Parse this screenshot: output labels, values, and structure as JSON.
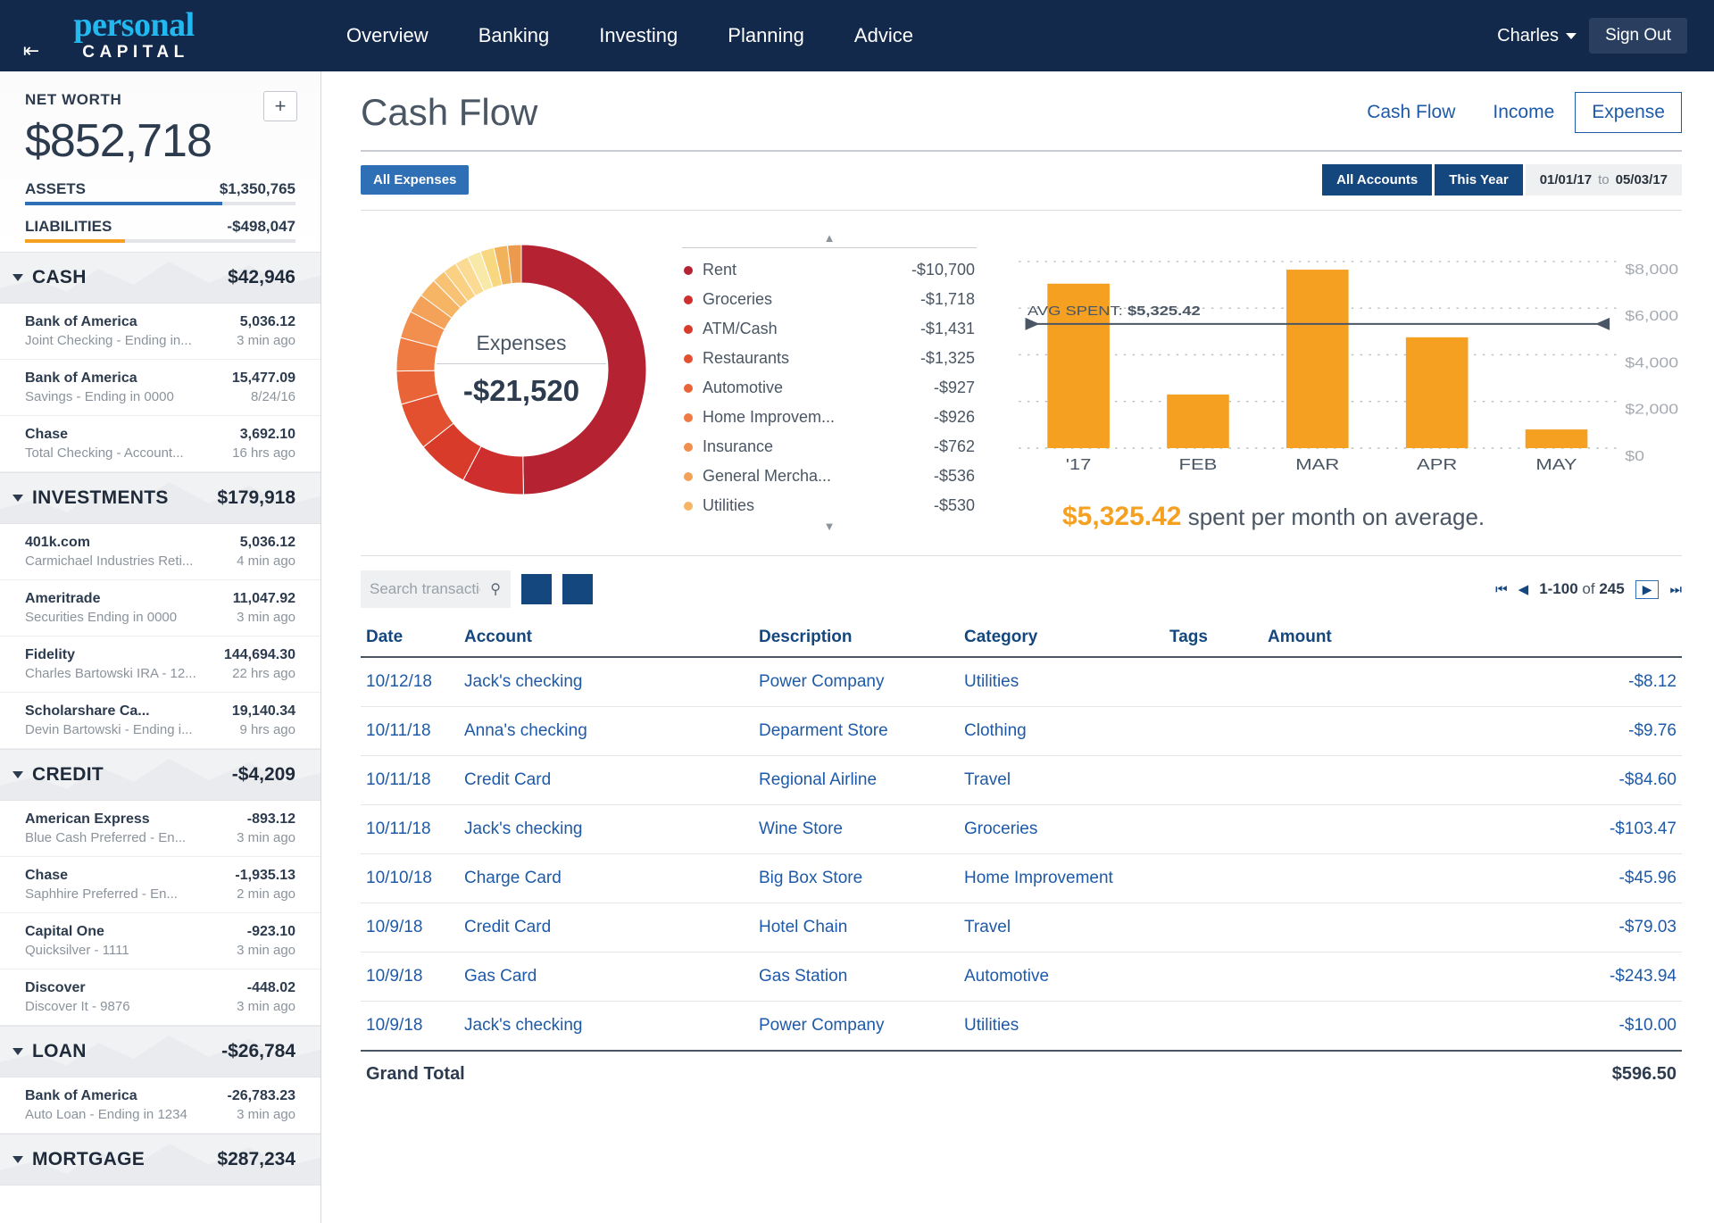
{
  "nav": {
    "collapse_icon": "collapse-left-icon",
    "brand_top": "personal",
    "brand_bottom": "CAPITAL",
    "links": [
      "Overview",
      "Banking",
      "Investing",
      "Planning",
      "Advice"
    ],
    "user": "Charles",
    "signout": "Sign Out"
  },
  "sidebar": {
    "net_worth_label": "NET WORTH",
    "net_worth_value": "$852,718",
    "add_label": "+",
    "assets_label": "ASSETS",
    "assets_value": "$1,350,765",
    "assets_color": "#2f6fb5",
    "liabilities_label": "LIABILITIES",
    "liabilities_value": "-$498,047",
    "liabilities_color": "#f6a022",
    "sections": [
      {
        "title": "CASH",
        "amount": "$42,946",
        "accounts": [
          {
            "name": "Bank of America",
            "sub": "Joint Checking - Ending in...",
            "value": "5,036.12",
            "time": "3 min ago"
          },
          {
            "name": "Bank of America",
            "sub": "Savings - Ending in 0000",
            "value": "15,477.09",
            "time": "8/24/16"
          },
          {
            "name": "Chase",
            "sub": "Total Checking - Account...",
            "value": "3,692.10",
            "time": "16 hrs ago"
          }
        ]
      },
      {
        "title": "INVESTMENTS",
        "amount": "$179,918",
        "accounts": [
          {
            "name": "401k.com",
            "sub": "Carmichael Industries Reti...",
            "value": "5,036.12",
            "time": "4 min ago"
          },
          {
            "name": "Ameritrade",
            "sub": "Securities Ending in 0000",
            "value": "11,047.92",
            "time": "3 min ago"
          },
          {
            "name": "Fidelity",
            "sub": "Charles Bartowski IRA - 12...",
            "value": "144,694.30",
            "time": "22 hrs ago"
          },
          {
            "name": "Scholarshare Ca...",
            "sub": "Devin Bartowski - Ending i...",
            "value": "19,140.34",
            "time": "9 hrs ago"
          }
        ]
      },
      {
        "title": "CREDIT",
        "amount": "-$4,209",
        "accounts": [
          {
            "name": "American Express",
            "sub": "Blue Cash Preferred - En...",
            "value": "-893.12",
            "time": "3 min ago"
          },
          {
            "name": "Chase",
            "sub": "Saphhire Preferred - En...",
            "value": "-1,935.13",
            "time": "2 min ago"
          },
          {
            "name": "Capital One",
            "sub": "Quicksilver - 1111",
            "value": "-923.10",
            "time": "3 min ago"
          },
          {
            "name": "Discover",
            "sub": "Discover It - 9876",
            "value": "-448.02",
            "time": "3 min ago"
          }
        ]
      },
      {
        "title": "LOAN",
        "amount": "-$26,784",
        "accounts": [
          {
            "name": "Bank of America",
            "sub": "Auto Loan - Ending in 1234",
            "value": "-26,783.23",
            "time": "3 min ago"
          }
        ]
      },
      {
        "title": "MORTGAGE",
        "amount": "$287,234",
        "accounts": []
      }
    ]
  },
  "page": {
    "title": "Cash Flow",
    "tabs": [
      {
        "label": "Cash Flow",
        "active": false
      },
      {
        "label": "Income",
        "active": false
      },
      {
        "label": "Expense",
        "active": true
      }
    ],
    "filter_left": "All Expenses",
    "accounts_filter": "All Accounts",
    "period_filter": "This Year",
    "date_from": "01/01/17",
    "date_to_word": "to",
    "date_to": "05/03/17"
  },
  "chart_data": [
    {
      "type": "pie",
      "title": "Expenses",
      "center_value": "-$21,520",
      "total": -21520,
      "categories": [
        "Rent",
        "Groceries",
        "ATM/Cash",
        "Restaurants",
        "Automotive",
        "Home Improvem...",
        "Insurance",
        "General Mercha...",
        "Utilities"
      ],
      "values": [
        -10700,
        -1718,
        -1431,
        -1325,
        -927,
        -926,
        -762,
        -536,
        -530
      ],
      "labels": [
        "-$10,700",
        "-$1,718",
        "-$1,431",
        "-$1,325",
        "-$927",
        "-$926",
        "-$762",
        "-$536",
        "-$530"
      ],
      "colors": [
        "#b52332",
        "#cf2e2e",
        "#d93b2b",
        "#e2502f",
        "#e96437",
        "#ef7a42",
        "#f28e4e",
        "#f4a259",
        "#f6b465"
      ],
      "legend_position": "right"
    },
    {
      "type": "bar",
      "title": "",
      "categories": [
        "'17",
        "FEB",
        "MAR",
        "APR",
        "MAY"
      ],
      "values": [
        7050,
        2300,
        7650,
        4750,
        800
      ],
      "ylim": [
        0,
        8800
      ],
      "yticks": [
        0,
        2000,
        4000,
        6000,
        8000
      ],
      "ytick_labels": [
        "$0",
        "$2,000",
        "$4,000",
        "$6,000",
        "$8,000"
      ],
      "grid": true,
      "bar_color": "#f6a022",
      "average_line": 5325.42,
      "average_label_prefix": "AVG SPENT:",
      "average_label_value": "$5,325.42",
      "caption_amount": "$5,325.42",
      "caption_text": "spent per month on average."
    }
  ],
  "transactions": {
    "search_placeholder": "Search transactions",
    "search_value": "",
    "search_icon": "search-icon",
    "button1_icon": "filter-icon",
    "button2_icon": "export-icon",
    "pager": {
      "first_icon": "⏮",
      "prev_icon": "◀",
      "range": "1-100",
      "of_word": "of",
      "total": "245",
      "next_icon": "▶",
      "last_icon": "⏭"
    },
    "columns": [
      "Date",
      "Account",
      "Description",
      "Category",
      "Tags",
      "Amount"
    ],
    "rows": [
      {
        "date": "10/12/18",
        "account": "Jack's checking",
        "description": "Power Company",
        "category": "Utilities",
        "tags": "",
        "amount": "-$8.12"
      },
      {
        "date": "10/11/18",
        "account": "Anna's checking",
        "description": "Deparment Store",
        "category": "Clothing",
        "tags": "",
        "amount": "-$9.76"
      },
      {
        "date": "10/11/18",
        "account": "Credit Card",
        "description": "Regional Airline",
        "category": "Travel",
        "tags": "",
        "amount": "-$84.60"
      },
      {
        "date": "10/11/18",
        "account": "Jack's checking",
        "description": "Wine Store",
        "category": "Groceries",
        "tags": "",
        "amount": "-$103.47"
      },
      {
        "date": "10/10/18",
        "account": "Charge Card",
        "description": "Big Box Store",
        "category": "Home Improvement",
        "tags": "",
        "amount": "-$45.96"
      },
      {
        "date": "10/9/18",
        "account": "Credit Card",
        "description": "Hotel Chain",
        "category": "Travel",
        "tags": "",
        "amount": "-$79.03"
      },
      {
        "date": "10/9/18",
        "account": "Gas Card",
        "description": "Gas Station",
        "category": "Automotive",
        "tags": "",
        "amount": "-$243.94"
      },
      {
        "date": "10/9/18",
        "account": "Jack's checking",
        "description": "Power Company",
        "category": "Utilities",
        "tags": "",
        "amount": "-$10.00"
      }
    ],
    "total_label": "Grand Total",
    "total_amount": "$596.50"
  }
}
